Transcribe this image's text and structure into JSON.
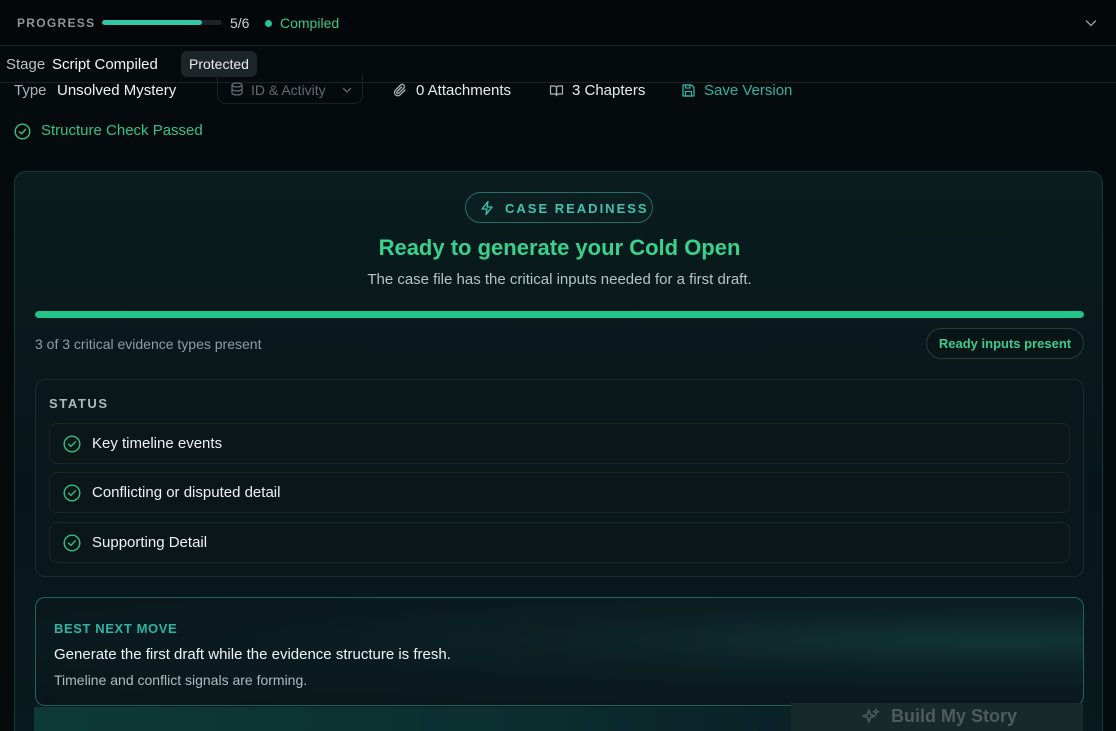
{
  "topbar": {
    "progress_label": "PROGRESS",
    "progress_fraction": 0.8333,
    "progress_count": "5/6",
    "status": "Compiled",
    "status_color": "#2fc38a"
  },
  "stage": {
    "key": "Stage",
    "value": "Script Compiled",
    "badge": "Protected"
  },
  "meta": {
    "type_key": "Type",
    "type_value": "Unsolved Mystery",
    "id_activity": "ID & Activity",
    "attachments": "0 Attachments",
    "chapters": "3 Chapters",
    "save_version": "Save Version"
  },
  "structure_check": "Structure Check Passed",
  "readiness": {
    "badge": "CASE READINESS",
    "headline": "Ready to generate your Cold Open",
    "subline": "The case file has the critical inputs needed for a first draft.",
    "progress_fraction": 1.0,
    "count_text": "3 of 3 critical evidence types present",
    "ready_pill": "Ready inputs present"
  },
  "status_panel": {
    "title": "STATUS",
    "items": [
      {
        "label": "Key timeline events"
      },
      {
        "label": "Conflicting or disputed detail"
      },
      {
        "label": "Supporting Detail"
      }
    ]
  },
  "next_move": {
    "label": "BEST NEXT MOVE",
    "title": "Generate the first draft while the evidence structure is fresh.",
    "description": "Timeline and conflict signals are forming."
  },
  "build_button": "Build My Story",
  "colors": {
    "accent_teal": "#2fb3a4",
    "accent_green": "#39d18e",
    "background": "#050a0d"
  }
}
